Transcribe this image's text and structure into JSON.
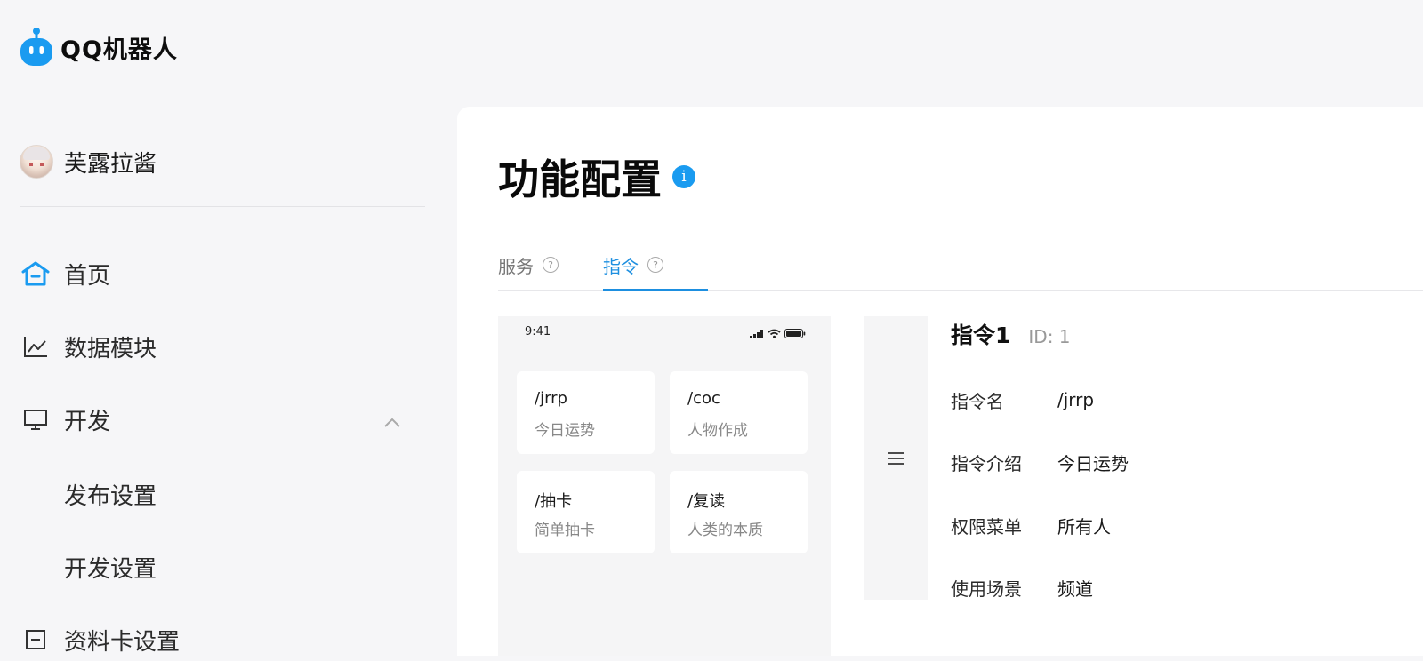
{
  "app": {
    "logo_text": "QQ机器人",
    "brand_color": "#1a9bf0"
  },
  "sidebar": {
    "user_name": "芙露拉酱",
    "items": [
      {
        "label": "首页",
        "icon": "home-icon"
      },
      {
        "label": "数据模块",
        "icon": "chart-line-icon"
      },
      {
        "label": "开发",
        "icon": "monitor-icon",
        "expanded": true
      },
      {
        "label": "发布设置"
      },
      {
        "label": "开发设置"
      },
      {
        "label": "资料卡设置",
        "icon": "card-icon"
      }
    ]
  },
  "main": {
    "title": "功能配置",
    "tabs": [
      {
        "label": "服务",
        "help": "?"
      },
      {
        "label": "指令",
        "help": "?",
        "active": true
      }
    ]
  },
  "phone": {
    "time": "9:41",
    "cards": [
      {
        "cmd": "/jrrp",
        "desc": "今日运势"
      },
      {
        "cmd": "/coc",
        "desc": "人物作成"
      },
      {
        "cmd": "/抽卡",
        "desc": "简单抽卡"
      },
      {
        "cmd": "/复读",
        "desc": "人类的本质"
      }
    ]
  },
  "detail": {
    "name": "指令1",
    "id": "ID: 1",
    "fields": [
      {
        "key": "指令名",
        "value": "/jrrp"
      },
      {
        "key": "指令介绍",
        "value": "今日运势"
      },
      {
        "key": "权限菜单",
        "value": "所有人"
      },
      {
        "key": "使用场景",
        "value": "频道"
      }
    ]
  }
}
